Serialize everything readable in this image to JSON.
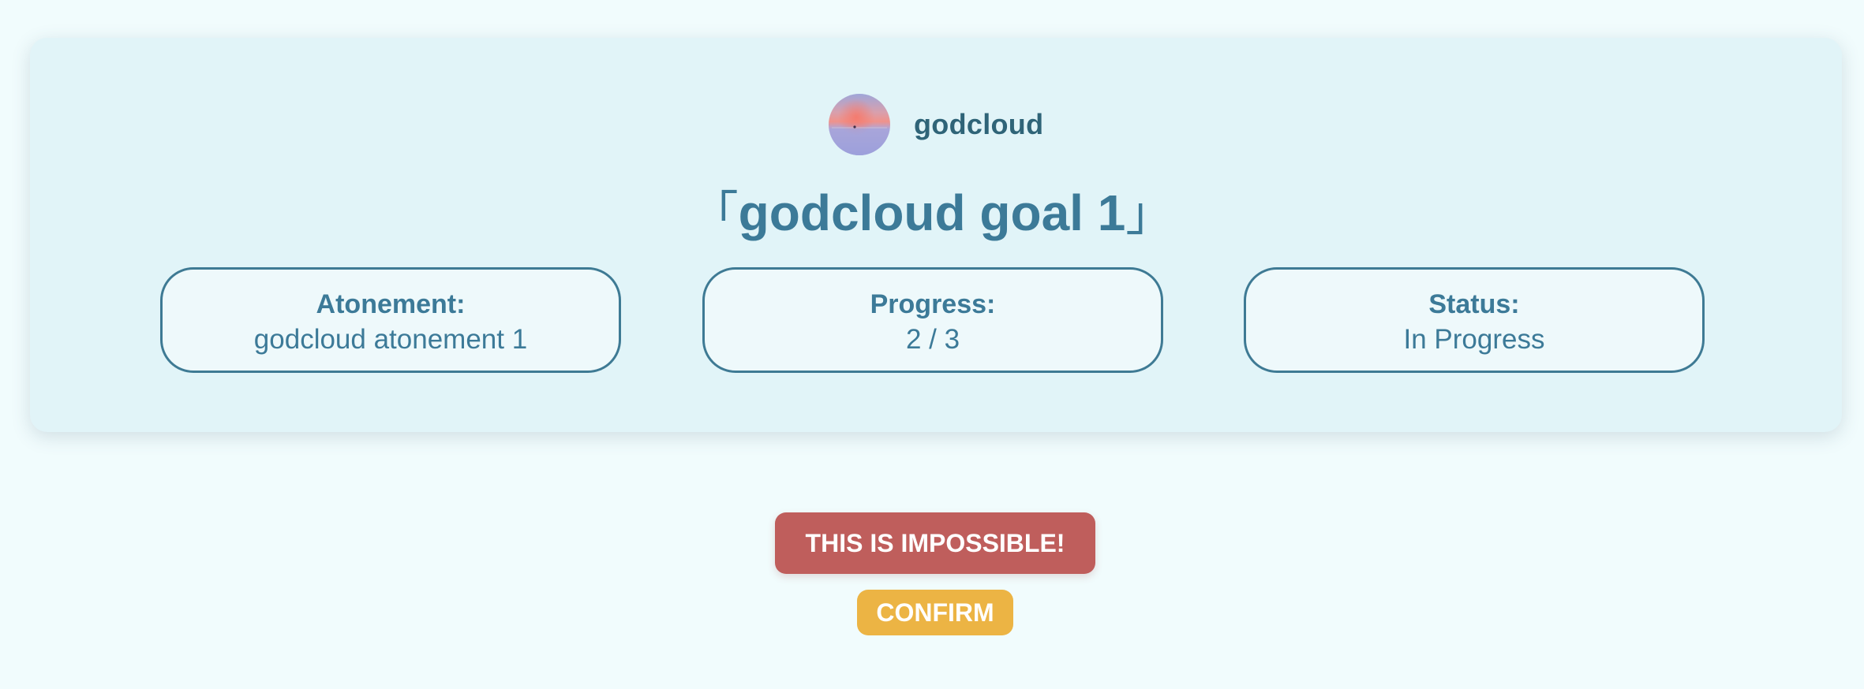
{
  "user": {
    "name": "godcloud",
    "avatar_icon": "sunset-landscape-avatar"
  },
  "goal": {
    "open_bracket": "「",
    "title": "godcloud goal 1",
    "close_bracket": "」"
  },
  "info": {
    "atonement": {
      "label": "Atonement:",
      "value": "godcloud atonement 1"
    },
    "progress": {
      "label": "Progress:",
      "value": "2 / 3"
    },
    "status": {
      "label": "Status:",
      "value": "In Progress"
    }
  },
  "actions": {
    "impossible_label": "THIS IS IMPOSSIBLE!",
    "confirm_label": "CONFIRM"
  },
  "colors": {
    "page_bg": "#f1fcfd",
    "card_bg": "#e1f4f8",
    "accent": "#3c7a98",
    "danger": "#bf5e5c",
    "warning": "#ecb444"
  }
}
